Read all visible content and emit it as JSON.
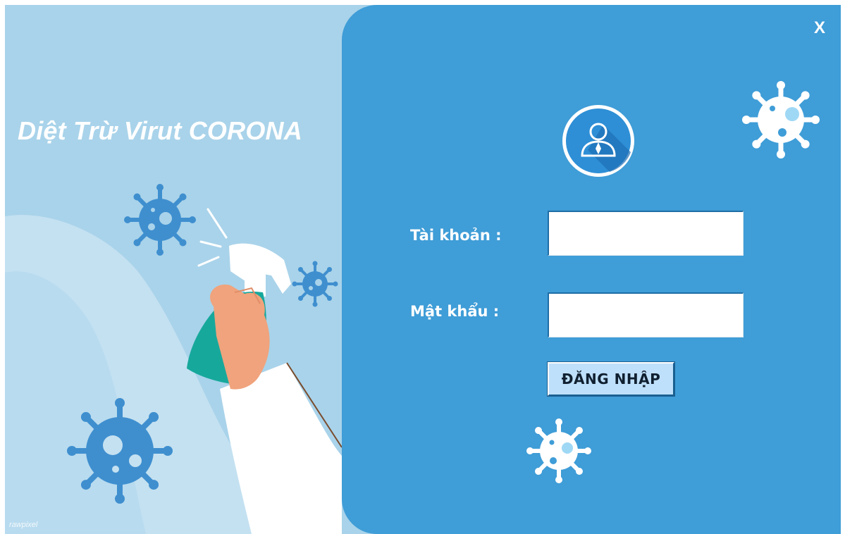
{
  "app": {
    "title": "Diệt Trừ Virut CORONA",
    "watermark": "rawpixel"
  },
  "login": {
    "username_label": "Tài khoản :",
    "username_value": "",
    "password_label": "Mật khẩu :",
    "password_value": "",
    "submit_label": "ĐĂNG NHẬP",
    "close_label": "X"
  },
  "icons": {
    "close": "close-icon",
    "avatar": "user-avatar-icon",
    "virus": "virus-icon",
    "spray": "spray-bottle-icon"
  },
  "colors": {
    "panel": "#3f9dd7",
    "illustration_bg": "#a9d3ea",
    "virus_dark": "#3f8fcf",
    "bottle": "#17a89c",
    "button": "#bfe0fb"
  }
}
